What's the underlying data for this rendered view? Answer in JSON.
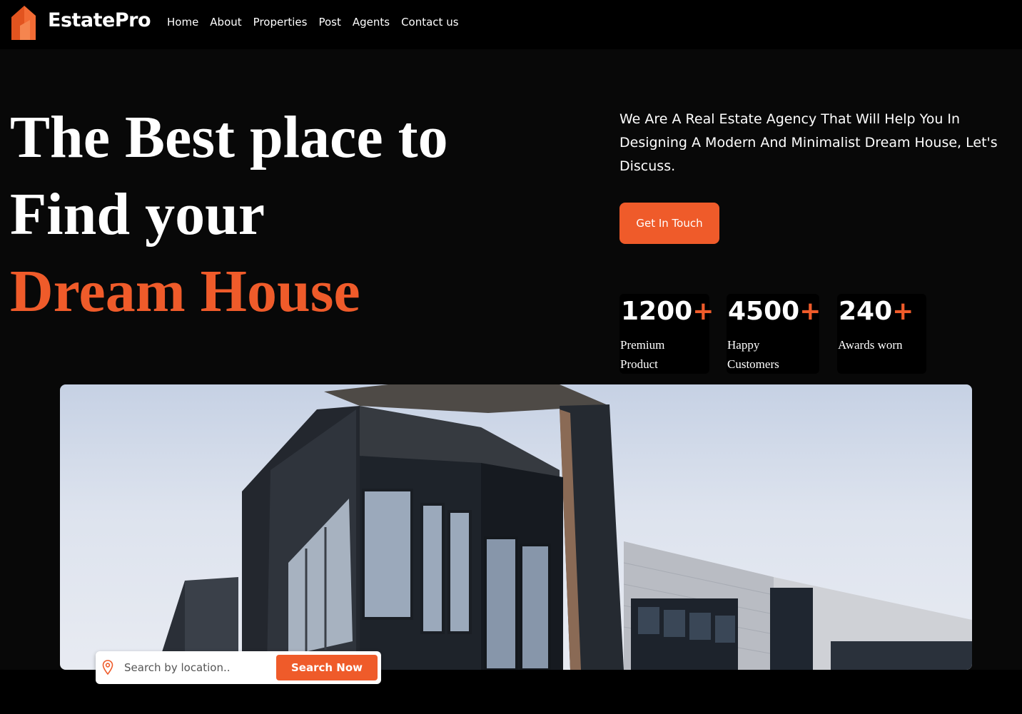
{
  "brand": {
    "name": "EstatePro",
    "logo_icon": "house-logo-icon",
    "accent_color": "#ef5b2a"
  },
  "nav": {
    "items": [
      {
        "label": "Home"
      },
      {
        "label": "About"
      },
      {
        "label": "Properties"
      },
      {
        "label": "Post"
      },
      {
        "label": "Agents"
      },
      {
        "label": "Contact us"
      }
    ]
  },
  "hero": {
    "headline_line1": "The Best place to",
    "headline_line2": "Find your",
    "headline_accent": "Dream House",
    "intro": "We Are A Real Estate Agency That Will Help You In Designing A Modern And Minimalist Dream House, Let's Discuss.",
    "cta_label": "Get In Touch",
    "stats": [
      {
        "value": "1200",
        "suffix": "+",
        "label_line1": "Premium",
        "label_line2": "Product"
      },
      {
        "value": "4500",
        "suffix": "+",
        "label_line1": "Happy",
        "label_line2": "Customers"
      },
      {
        "value": "240",
        "suffix": "+",
        "label_line1": "Awards worn",
        "label_line2": ""
      }
    ]
  },
  "search": {
    "placeholder": "Search by location..",
    "value": "",
    "icon": "location-pin-icon",
    "button_label": "Search Now"
  }
}
